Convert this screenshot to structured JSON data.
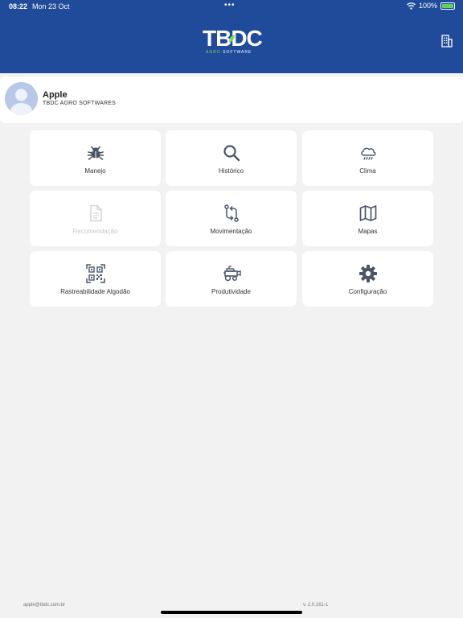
{
  "status_bar": {
    "time": "08:22",
    "date": "Mon 23 Oct",
    "dots": "•••",
    "battery_percent": "100%"
  },
  "header": {
    "logo_main": "TBDC",
    "logo_sub_agro": "AGRO",
    "logo_sub_software": "SOFTWARE"
  },
  "profile": {
    "name": "Apple",
    "company": "TBDC AGRO SOFTWARES"
  },
  "menu": {
    "manejo": "Manejo",
    "historico": "Histórico",
    "clima": "Clima",
    "recomendacao": "Recomendação",
    "movimentacao": "Movimentação",
    "mapas": "Mapas",
    "rastreabilidade": "Rastreabilidade Algodão",
    "produtividade": "Produtividade",
    "configuracao": "Configuração"
  },
  "footer": {
    "email": "apple@tbdc.com.br",
    "version": "v. 2.0.161-1"
  },
  "colors": {
    "header_bg": "#1f4b9a",
    "icon": "#4a5668",
    "tile_bg": "#ffffff",
    "page_bg": "#f2f2f2"
  }
}
